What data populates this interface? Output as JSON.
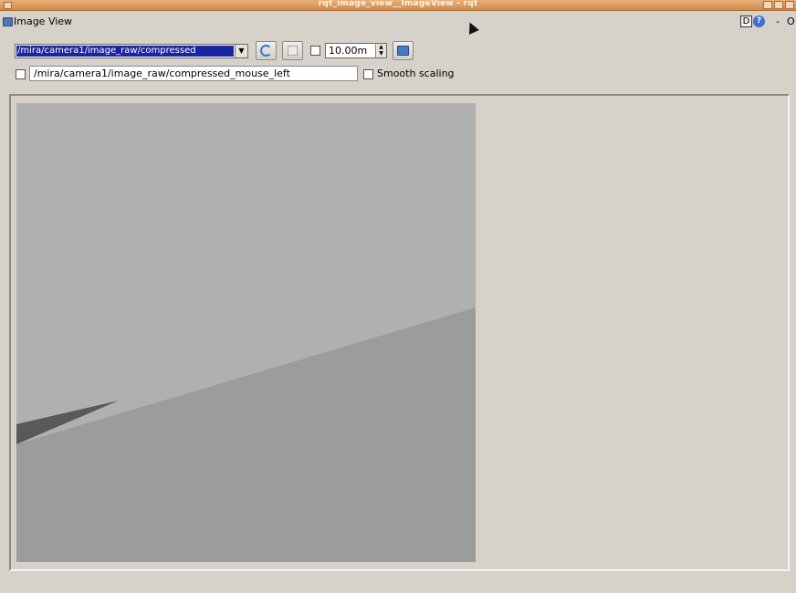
{
  "window": {
    "title": "rqt_image_view__ImageView - rqt"
  },
  "dock": {
    "title": "Image View",
    "d_label": "D",
    "help_label": "?",
    "dash_label": "-",
    "o_label": "O"
  },
  "toolbar": {
    "topic_selected": "/mira/camera1/image_raw/compressed",
    "rate_value": "10.00m",
    "mouse_topic": "/mira/camera1/image_raw/compressed_mouse_left",
    "smooth_label": "Smooth scaling"
  },
  "colors": {
    "titlebar_accent": "#d08a4c",
    "selection": "#1a25a0",
    "image_upper": "#b0b0b0",
    "image_lower": "#9c9c9c",
    "image_dark_strip": "#595959"
  },
  "icons": {
    "refresh": "refresh-icon",
    "pause": "pause-icon",
    "save": "save-icon",
    "dock": "image-view-icon",
    "help": "help-icon"
  }
}
